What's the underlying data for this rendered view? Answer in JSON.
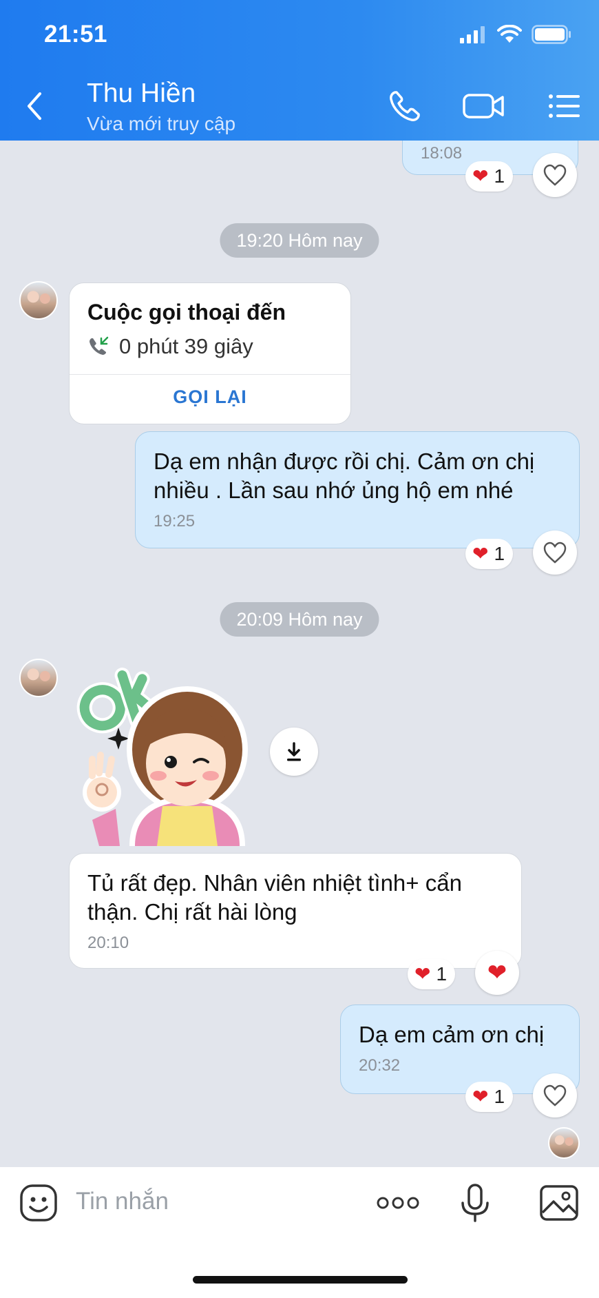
{
  "status_bar": {
    "time": "21:51"
  },
  "header": {
    "contact_name": "Thu Hiền",
    "contact_status": "Vừa mới truy cập",
    "icons": [
      "back-icon",
      "phone-icon",
      "video-icon",
      "menu-icon"
    ]
  },
  "messages": {
    "top_partial": {
      "time": "18:08",
      "reaction_count": "1"
    },
    "divider_1": "19:20 Hôm nay",
    "call_card": {
      "title": "Cuộc gọi thoại đến",
      "duration": "0 phút 39 giây",
      "action": "GỌI LẠI"
    },
    "out_1": {
      "line1": "Dạ em nhận được rồi chị. Cảm ơn chị",
      "line2": "nhiều . Lần sau nhớ ủng hộ em nhé",
      "time": "19:25",
      "reaction_count": "1"
    },
    "divider_2": "20:09 Hôm nay",
    "sticker": {
      "text": "ok"
    },
    "in_1": {
      "line1": "Tủ rất đẹp. Nhân viên nhiệt tình+  cẩn",
      "line2": "thận. Chị rất hài lòng",
      "time": "20:10",
      "reaction_count": "1"
    },
    "out_2": {
      "text": "Dạ em cảm ơn chị",
      "time": "20:32",
      "reaction_count": "1"
    }
  },
  "composer": {
    "placeholder": "Tin nhắn",
    "icons": [
      "emoji-icon",
      "more-icon",
      "microphone-icon",
      "image-icon"
    ]
  },
  "colors": {
    "header_blue": "#2d8af0",
    "outgoing_bubble": "#d5ebfd",
    "heart_red": "#e0202a",
    "link_blue": "#2a76d2"
  }
}
